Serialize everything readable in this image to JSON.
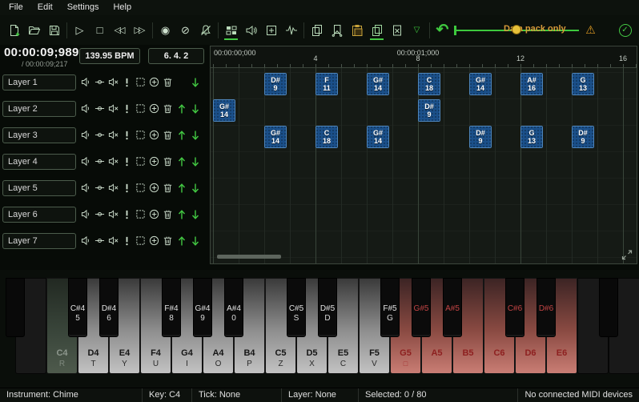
{
  "menu": {
    "items": [
      "File",
      "Edit",
      "Settings",
      "Help"
    ]
  },
  "toolbar": {
    "data_pack_label": "Data pack only",
    "accent_color": "#44c944",
    "notice_color": "#e8c23a"
  },
  "transport": {
    "time_current": "00:00:09;989",
    "time_total": "/ 00:00:09;217",
    "bpm": "139.95 BPM",
    "position": "6. 4. 2"
  },
  "ruler": {
    "time_labels": [
      {
        "beat": 0,
        "text": "00:00:00;000"
      },
      {
        "beat": 8,
        "text": "00:00:01;000"
      }
    ],
    "beat_numbers": [
      {
        "beat": 4,
        "text": "4"
      },
      {
        "beat": 8,
        "text": "8"
      },
      {
        "beat": 12,
        "text": "12"
      },
      {
        "beat": 16,
        "text": "16"
      }
    ]
  },
  "layers": [
    {
      "name": "Layer 1",
      "can_move_up": false,
      "can_move_down": true
    },
    {
      "name": "Layer 2",
      "can_move_up": true,
      "can_move_down": true
    },
    {
      "name": "Layer 3",
      "can_move_up": true,
      "can_move_down": true
    },
    {
      "name": "Layer 4",
      "can_move_up": true,
      "can_move_down": true
    },
    {
      "name": "Layer 5",
      "can_move_up": true,
      "can_move_down": true
    },
    {
      "name": "Layer 6",
      "can_move_up": true,
      "can_move_down": true
    },
    {
      "name": "Layer 7",
      "can_move_up": true,
      "can_move_down": true
    }
  ],
  "notes": [
    {
      "row": 0,
      "beat": 2,
      "name": "D#",
      "key": "9"
    },
    {
      "row": 0,
      "beat": 4,
      "name": "F",
      "key": "11"
    },
    {
      "row": 0,
      "beat": 6,
      "name": "G#",
      "key": "14"
    },
    {
      "row": 0,
      "beat": 8,
      "name": "C",
      "key": "18"
    },
    {
      "row": 0,
      "beat": 10,
      "name": "G#",
      "key": "14"
    },
    {
      "row": 0,
      "beat": 12,
      "name": "A#",
      "key": "16"
    },
    {
      "row": 0,
      "beat": 14,
      "name": "G",
      "key": "13"
    },
    {
      "row": 1,
      "beat": 0,
      "name": "G#",
      "key": "14"
    },
    {
      "row": 1,
      "beat": 8,
      "name": "D#",
      "key": "9"
    },
    {
      "row": 2,
      "beat": 2,
      "name": "G#",
      "key": "14"
    },
    {
      "row": 2,
      "beat": 4,
      "name": "C",
      "key": "18"
    },
    {
      "row": 2,
      "beat": 6,
      "name": "G#",
      "key": "14"
    },
    {
      "row": 2,
      "beat": 10,
      "name": "D#",
      "key": "9"
    },
    {
      "row": 2,
      "beat": 12,
      "name": "G",
      "key": "13"
    },
    {
      "row": 2,
      "beat": 14,
      "name": "D#",
      "key": "9"
    }
  ],
  "piano": {
    "white_keys": [
      {
        "note": "C4",
        "binding": "R",
        "state": "current"
      },
      {
        "note": "D4",
        "binding": "T",
        "state": "normal"
      },
      {
        "note": "E4",
        "binding": "Y",
        "state": "normal"
      },
      {
        "note": "F4",
        "binding": "U",
        "state": "normal"
      },
      {
        "note": "G4",
        "binding": "I",
        "state": "normal"
      },
      {
        "note": "A4",
        "binding": "O",
        "state": "normal"
      },
      {
        "note": "B4",
        "binding": "P",
        "state": "normal"
      },
      {
        "note": "C5",
        "binding": "Z",
        "state": "normal"
      },
      {
        "note": "D5",
        "binding": "X",
        "state": "normal"
      },
      {
        "note": "E5",
        "binding": "C",
        "state": "normal"
      },
      {
        "note": "F5",
        "binding": "V",
        "state": "normal"
      },
      {
        "note": "G5",
        "binding": "□",
        "state": "out-of-range"
      },
      {
        "note": "A5",
        "binding": "",
        "state": "out-of-range"
      },
      {
        "note": "B5",
        "binding": "",
        "state": "out-of-range"
      },
      {
        "note": "C6",
        "binding": "",
        "state": "out-of-range"
      },
      {
        "note": "D6",
        "binding": "",
        "state": "out-of-range"
      },
      {
        "note": "E6",
        "binding": "",
        "state": "out-of-range"
      }
    ],
    "black_keys": [
      {
        "note": "C#4",
        "binding": "5",
        "after": 0,
        "state": "normal"
      },
      {
        "note": "D#4",
        "binding": "6",
        "after": 1,
        "state": "normal"
      },
      {
        "note": "F#4",
        "binding": "8",
        "after": 3,
        "state": "normal"
      },
      {
        "note": "G#4",
        "binding": "9",
        "after": 4,
        "state": "normal"
      },
      {
        "note": "A#4",
        "binding": "0",
        "after": 5,
        "state": "normal"
      },
      {
        "note": "C#5",
        "binding": "S",
        "after": 7,
        "state": "normal"
      },
      {
        "note": "D#5",
        "binding": "D",
        "after": 8,
        "state": "normal"
      },
      {
        "note": "F#5",
        "binding": "G",
        "after": 10,
        "state": "normal"
      },
      {
        "note": "G#5",
        "binding": "",
        "after": 11,
        "state": "out-of-range"
      },
      {
        "note": "A#5",
        "binding": "",
        "after": 12,
        "state": "out-of-range"
      },
      {
        "note": "C#6",
        "binding": "",
        "after": 14,
        "state": "out-of-range"
      },
      {
        "note": "D#6",
        "binding": "",
        "after": 15,
        "state": "out-of-range"
      }
    ]
  },
  "status": {
    "instrument": "Instrument: Chime",
    "key": "Key: C4",
    "tick": "Tick: None",
    "layer": "Layer: None",
    "selected": "Selected: 0 / 80",
    "midi": "No connected MIDI devices"
  }
}
